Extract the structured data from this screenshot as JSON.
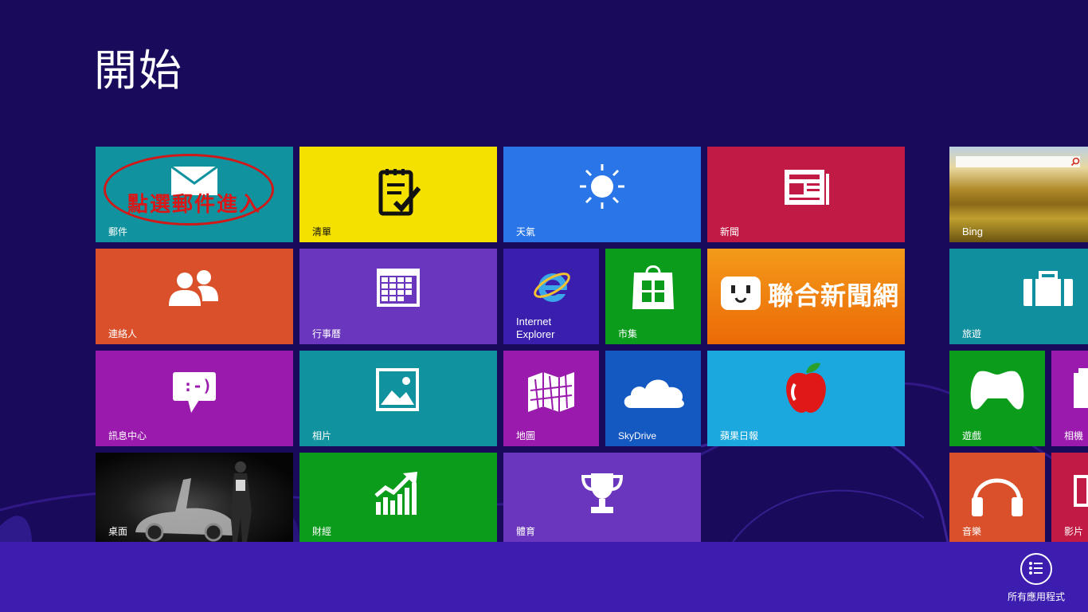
{
  "screen_title": "開始",
  "tiles": {
    "mail": {
      "label": "郵件",
      "color": "#10939e",
      "icon": "mail-icon"
    },
    "todo": {
      "label": "清單",
      "color": "#f5e100",
      "icon": "notepad-check-icon"
    },
    "weather": {
      "label": "天氣",
      "color": "#2a76e8",
      "icon": "sun-icon"
    },
    "news": {
      "label": "新聞",
      "color": "#c11b45",
      "icon": "newspaper-icon"
    },
    "bing": {
      "label": "Bing",
      "icon": "landscape-photo"
    },
    "contacts": {
      "label": "連絡人",
      "color": "#d9502a",
      "icon": "people-icon"
    },
    "calendar": {
      "label": "行事曆",
      "color": "#6a36bd",
      "icon": "calendar-icon"
    },
    "ie": {
      "label_line1": "Internet",
      "label_line2": "Explorer",
      "color": "#3a1fae",
      "icon": "ie-icon"
    },
    "store": {
      "label": "市集",
      "color": "#0c9c1c",
      "icon": "store-bag-icon"
    },
    "udn": {
      "label": "聯合新聞網",
      "color": "#f07a0a",
      "icon": "udn-face-icon"
    },
    "travel": {
      "label": "旅遊",
      "color": "#108f9e",
      "icon": "suitcase-icon"
    },
    "messaging": {
      "label": "訊息中心",
      "color": "#9a1aad",
      "icon": "chat-smile-icon",
      "icon_text": ":-)"
    },
    "photos": {
      "label": "相片",
      "color": "#10939e",
      "icon": "picture-icon"
    },
    "maps": {
      "label": "地圖",
      "color": "#9a1aad",
      "icon": "map-icon"
    },
    "skydrive": {
      "label": "SkyDrive",
      "color": "#1458c2",
      "icon": "cloud-icon"
    },
    "apple_daily": {
      "label": "蘋果日報",
      "color": "#1aa8de",
      "icon": "apple-icon"
    },
    "games": {
      "label": "遊戲",
      "color": "#0c9c1c",
      "icon": "xbox-controller-icon"
    },
    "camera": {
      "label": "相機",
      "color": "#9a1aad",
      "icon": "camera-icon"
    },
    "desktop": {
      "label": "桌面",
      "icon": "desktop-wallpaper"
    },
    "finance": {
      "label": "財經",
      "color": "#0c9c1c",
      "icon": "chart-up-icon"
    },
    "sports": {
      "label": "體育",
      "color": "#6a36bd",
      "icon": "trophy-icon"
    },
    "music": {
      "label": "音樂",
      "color": "#d9502a",
      "icon": "headphones-icon"
    },
    "video": {
      "label": "影片",
      "color": "#c11b45",
      "icon": "video-icon"
    }
  },
  "annotation": {
    "text": "點選郵件進入",
    "color": "#d01818"
  },
  "all_apps": {
    "label": "所有應用程式",
    "icon": "list-icon"
  }
}
